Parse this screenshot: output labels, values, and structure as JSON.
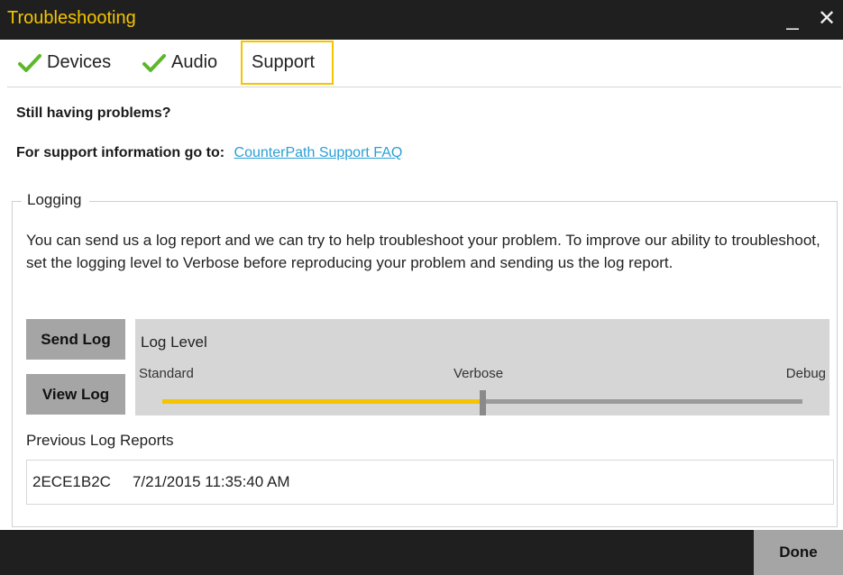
{
  "window": {
    "title": "Troubleshooting",
    "minimize_glyph": "_",
    "close_glyph": "✕"
  },
  "tabs": [
    {
      "label": "Devices",
      "checked": true,
      "icon": "checkmark-icon"
    },
    {
      "label": "Audio",
      "checked": true,
      "icon": "checkmark-icon"
    },
    {
      "label": "Support",
      "selected": true
    }
  ],
  "support": {
    "heading": "Still having problems?",
    "info_label": "For support information go to:",
    "link_text": "CounterPath Support FAQ"
  },
  "logging": {
    "legend": "Logging",
    "description": "You can send us a log report and we can try to help troubleshoot your problem. To improve our ability to troubleshoot, set the logging level to Verbose before reproducing your problem and sending us the log report.",
    "send_log_label": "Send Log",
    "view_log_label": "View Log",
    "level_title": "Log Level",
    "levels": [
      "Standard",
      "Verbose",
      "Debug"
    ],
    "selected_level": "Verbose",
    "slider_fraction": 0.5,
    "previous_title": "Previous Log Reports",
    "reports": [
      {
        "id": "2ECE1B2C",
        "datetime": "7/21/2015 11:35:40 AM"
      }
    ]
  },
  "footer": {
    "done_label": "Done"
  },
  "colors": {
    "accent": "#f5c400",
    "titlebar": "#1f1f1f",
    "link": "#2a9fd6",
    "button": "#a5a5a5"
  }
}
